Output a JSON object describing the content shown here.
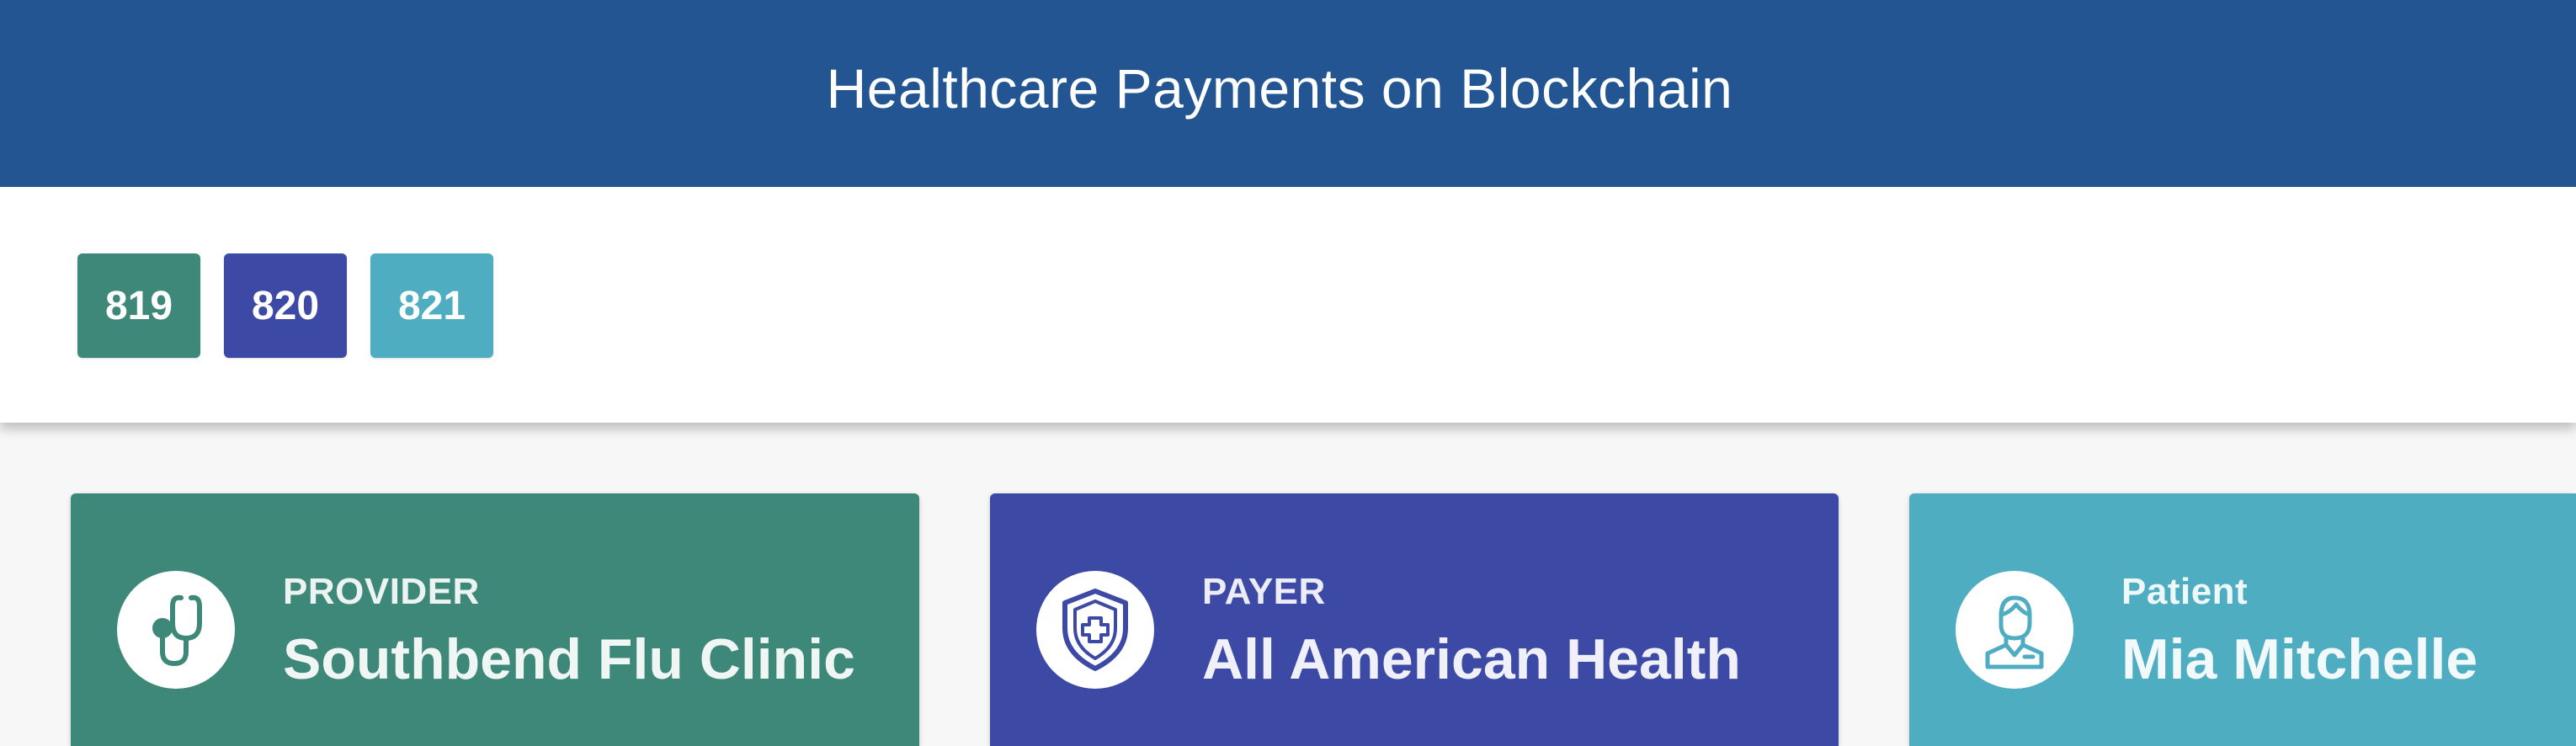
{
  "header": {
    "title": "Healthcare Payments on Blockchain",
    "background": "#225592"
  },
  "blocks": [
    {
      "label": "819",
      "color": "#3d8878"
    },
    {
      "label": "820",
      "color": "#3d4aa5"
    },
    {
      "label": "821",
      "color": "#4fadc1"
    }
  ],
  "cards": [
    {
      "role": "PROVIDER",
      "name": "Southbend Flu Clinic",
      "icon": "stethoscope-icon",
      "color": "#3d8878"
    },
    {
      "role": "PAYER",
      "name": "All American Health",
      "icon": "shield-plus-icon",
      "color": "#3d4aa5"
    },
    {
      "role": "Patient",
      "name": "Mia Mitchelle",
      "icon": "user-icon",
      "color": "#4fadc1"
    }
  ]
}
